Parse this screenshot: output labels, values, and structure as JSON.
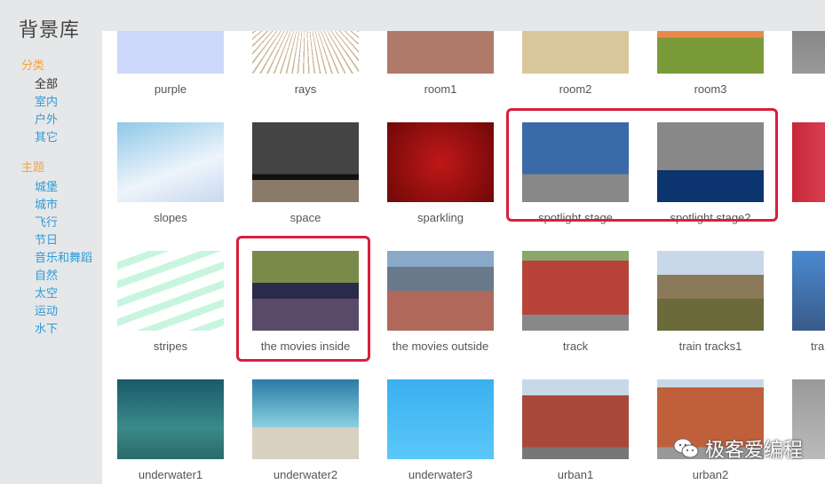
{
  "title": "背景库",
  "sidebar": {
    "category_heading": "分类",
    "categories": [
      "全部",
      "室内",
      "户外",
      "其它"
    ],
    "theme_heading": "主题",
    "themes": [
      "城堡",
      "城市",
      "飞行",
      "节日",
      "音乐和舞蹈",
      "自然",
      "太空",
      "运动",
      "水下"
    ],
    "active": "全部"
  },
  "colors": {
    "heading": "#f5a33a",
    "link": "#2e9bd6",
    "highlight": "#d8203a"
  },
  "grid": [
    [
      "purple",
      "rays",
      "room1",
      "room2",
      "room3",
      ""
    ],
    [
      "slopes",
      "space",
      "sparkling",
      "spotlight stage",
      "spotlight stage2",
      ""
    ],
    [
      "stripes",
      "the movies inside",
      "the movies outside",
      "track",
      "train tracks1",
      "tra"
    ],
    [
      "underwater1",
      "underwater2",
      "underwater3",
      "urban1",
      "urban2",
      ""
    ]
  ],
  "highlighted": [
    "spotlight stage",
    "spotlight stage2",
    "the movies inside"
  ],
  "watermark": "极客爱编程"
}
